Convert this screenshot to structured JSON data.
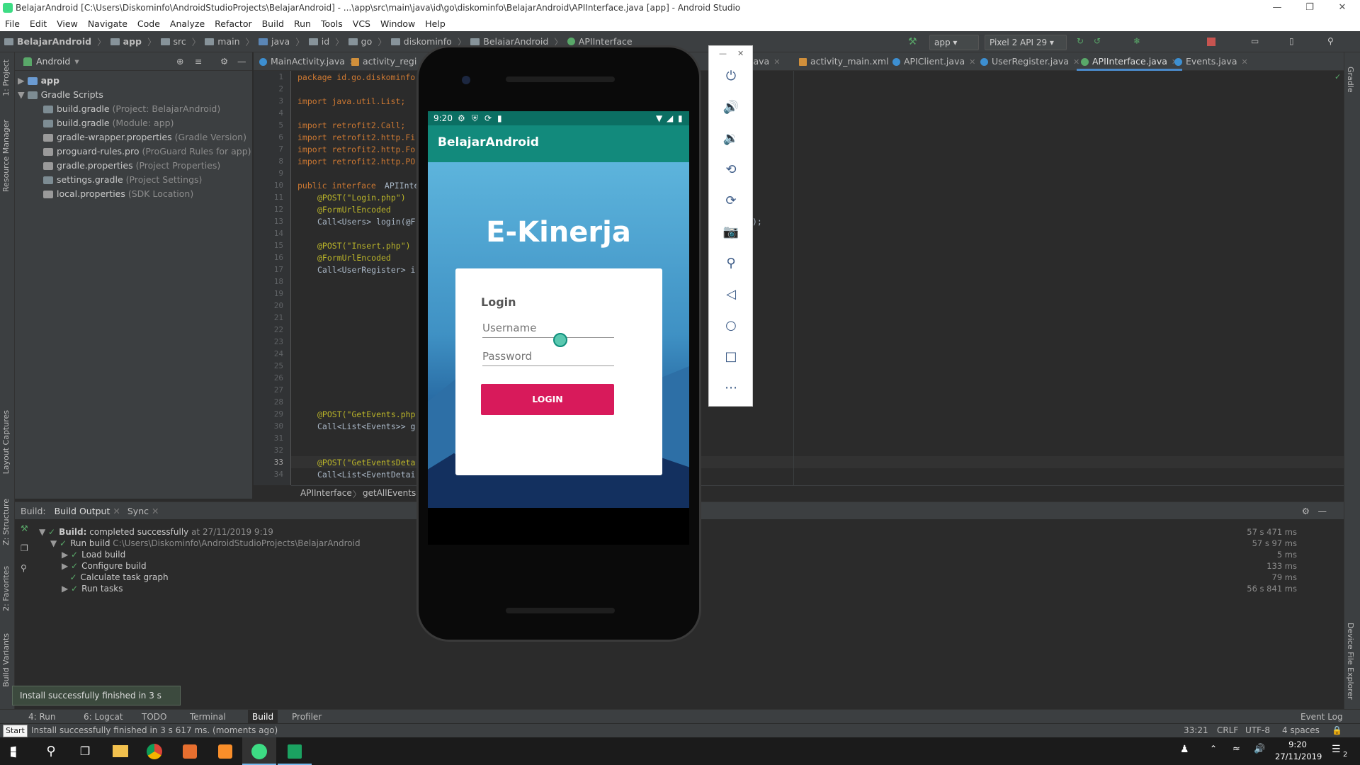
{
  "window": {
    "title": "BelajarAndroid [C:\\Users\\Diskominfo\\AndroidStudioProjects\\BelajarAndroid] - ...\\app\\src\\main\\java\\id\\go\\diskominfo\\BelajarAndroid\\APIInterface.java [app] - Android Studio"
  },
  "menu": [
    "File",
    "Edit",
    "View",
    "Navigate",
    "Code",
    "Analyze",
    "Refactor",
    "Build",
    "Run",
    "Tools",
    "VCS",
    "Window",
    "Help"
  ],
  "breadcrumb": [
    "BelajarAndroid",
    "app",
    "src",
    "main",
    "java",
    "id",
    "go",
    "diskominfo",
    "BelajarAndroid",
    "APIInterface"
  ],
  "toolbar": {
    "run_config": "app",
    "device": "Pixel 2 API 29"
  },
  "project": {
    "view": "Android",
    "items": [
      {
        "name": "app",
        "hint": ""
      },
      {
        "name": "Gradle Scripts",
        "hint": ""
      },
      {
        "name": "build.gradle",
        "hint": "(Project: BelajarAndroid)"
      },
      {
        "name": "build.gradle",
        "hint": "(Module: app)"
      },
      {
        "name": "gradle-wrapper.properties",
        "hint": "(Gradle Version)"
      },
      {
        "name": "proguard-rules.pro",
        "hint": "(ProGuard Rules for app)"
      },
      {
        "name": "gradle.properties",
        "hint": "(Project Properties)"
      },
      {
        "name": "settings.gradle",
        "hint": "(Project Settings)"
      },
      {
        "name": "local.properties",
        "hint": "(SDK Location)"
      }
    ]
  },
  "left_tabs": {
    "project": "1: Project",
    "resource": "Resource Manager",
    "layout": "Layout Captures",
    "structure": "Z: Structure",
    "favorites": "2: Favorites",
    "variants": "Build Variants"
  },
  "right_tabs": {
    "gradle": "Gradle",
    "device": "Device File Explorer"
  },
  "tabs": [
    "MainActivity.java",
    "activity_regi",
    "java",
    "activity_main.xml",
    "APIClient.java",
    "UserRegister.java",
    "APIInterface.java",
    "Events.java"
  ],
  "code": {
    "lines": [
      "1",
      "2",
      "3",
      "4",
      "5",
      "6",
      "7",
      "8",
      "9",
      "10",
      "11",
      "12",
      "13",
      "14",
      "15",
      "16",
      "17",
      "18",
      "19",
      "20",
      "21",
      "22",
      "23",
      "24",
      "25",
      "26",
      "27",
      "28",
      "29",
      "30",
      "31",
      "32",
      "33",
      "34"
    ],
    "l1": "package id.go.diskominfo",
    "l3": "import java.util.List;",
    "l5": "import retrofit2.Call;",
    "l6": "import retrofit2.http.Fi",
    "l7": "import retrofit2.http.Fo",
    "l8": "import retrofit2.http.PO",
    "l10a": "public interface",
    "l10b": " APIInte",
    "l11": "@POST(\"Login.php\")",
    "l12": "@FormUrlEncoded",
    "l13": "Call<Users> login(@F",
    "l15": "@POST(\"Insert.php\")",
    "l16": "@FormUrlEncoded",
    "l17": "Call<UserRegister> i",
    "l29": "@POST(\"GetEvents.php",
    "l30": "Call<List<Events>> g",
    "l33": "@POST(\"GetEventsDeta",
    "l34": "Call<List<EventDetai",
    "tail": ");"
  },
  "editor_crumbs": [
    "APIInterface",
    "getAllEventsD"
  ],
  "build": {
    "tabs": [
      "Build:",
      "Build Output",
      "Sync"
    ],
    "rows": [
      {
        "label": "Build:",
        "text": " completed successfully",
        "extra": " at 27/11/2019 9:19",
        "time": "57 s 471 ms"
      },
      {
        "label": "Run build",
        "text": " C:\\Users\\Diskominfo\\AndroidStudioProjects\\BelajarAndroid",
        "extra": "",
        "time": "57 s 97 ms"
      },
      {
        "label": "Load build",
        "text": "",
        "extra": "",
        "time": "5 ms"
      },
      {
        "label": "Configure build",
        "text": "",
        "extra": "",
        "time": "133 ms"
      },
      {
        "label": "Calculate task graph",
        "text": "",
        "extra": "",
        "time": "79 ms"
      },
      {
        "label": "Run tasks",
        "text": "",
        "extra": "",
        "time": "56 s 841 ms"
      }
    ]
  },
  "toast": "Install successfully finished in 3 s 617 ms.",
  "bottom_tabs": [
    "4: Run",
    "6: Logcat",
    "TODO",
    "Terminal",
    "Build",
    "Profiler",
    "Event Log"
  ],
  "status": {
    "message": "Install successfully finished in 3 s 617 ms. (moments ago)",
    "start": "Start",
    "position": "33:21",
    "crlf": "CRLF",
    "encoding": "UTF-8",
    "indent": "4 spaces"
  },
  "taskbar": {
    "time": "9:20",
    "date": "27/11/2019",
    "notif": "2"
  },
  "phone": {
    "status_time": "9:20",
    "app_title": "BelajarAndroid",
    "headline": "E-Kinerja",
    "card_title": "Login",
    "username_placeholder": "Username",
    "password_placeholder": "Password",
    "login_button": "LOGIN"
  },
  "colors": {
    "accent": "#d81a5b",
    "appbar": "#128a7c",
    "ide_bg": "#2b2b2b"
  }
}
